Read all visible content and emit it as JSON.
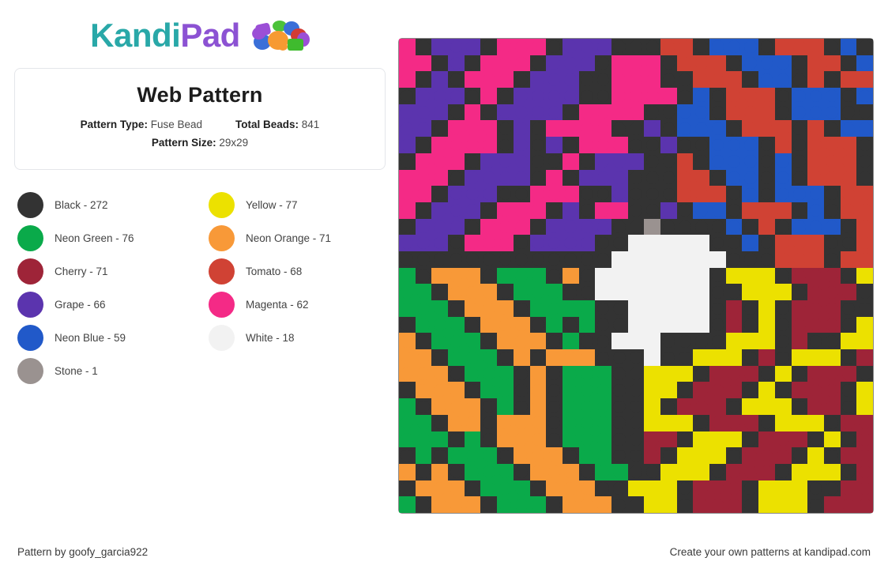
{
  "brand": {
    "name_part1": "Kandi",
    "name_part2": "Pad",
    "logo_icon": "kandi-beads-icon"
  },
  "pattern": {
    "title": "Web Pattern",
    "type_label": "Pattern Type:",
    "type_value": "Fuse Bead",
    "total_label": "Total Beads:",
    "total_value": "841",
    "size_label": "Pattern Size:",
    "size_value": "29x29"
  },
  "legend": {
    "items": [
      {
        "name": "Black",
        "count": 272,
        "label": "Black - 272",
        "color": "#333333"
      },
      {
        "name": "Yellow",
        "count": 77,
        "label": "Yellow - 77",
        "color": "#ece100"
      },
      {
        "name": "Neon Green",
        "count": 76,
        "label": "Neon Green - 76",
        "color": "#0aaa4a"
      },
      {
        "name": "Neon Orange",
        "count": 71,
        "label": "Neon Orange - 71",
        "color": "#f89938"
      },
      {
        "name": "Cherry",
        "count": 71,
        "label": "Cherry - 71",
        "color": "#9e2438"
      },
      {
        "name": "Tomato",
        "count": 68,
        "label": "Tomato - 68",
        "color": "#d04234"
      },
      {
        "name": "Grape",
        "count": 66,
        "label": "Grape - 66",
        "color": "#5b34ae"
      },
      {
        "name": "Magenta",
        "count": 62,
        "label": "Magenta - 62",
        "color": "#f42a86"
      },
      {
        "name": "Neon Blue",
        "count": 59,
        "label": "Neon Blue - 59",
        "color": "#2159c9"
      },
      {
        "name": "White",
        "count": 18,
        "label": "White - 18",
        "color": "#f2f2f2"
      },
      {
        "name": "Stone",
        "count": 1,
        "label": "Stone - 1",
        "color": "#9a9290"
      }
    ]
  },
  "footer": {
    "credit": "Pattern by goofy_garcia922",
    "promo": "Create your own patterns at kandipad.com"
  },
  "chart_data": {
    "type": "heatmap",
    "title": "Web Pattern",
    "rows": 29,
    "cols": 29,
    "palette": {
      "K": "#333333",
      "M": "#f42a86",
      "P": "#5b34ae",
      "R": "#d04234",
      "B": "#2159c9",
      "G": "#0aaa4a",
      "O": "#f89938",
      "Y": "#ece100",
      "C": "#9e2438",
      "W": "#f2f2f2",
      "S": "#9a9290"
    },
    "palette_names": {
      "K": "Black",
      "M": "Magenta",
      "P": "Grape",
      "R": "Tomato",
      "B": "Neon Blue",
      "G": "Neon Green",
      "O": "Neon Orange",
      "Y": "Yellow",
      "C": "Cherry",
      "W": "White",
      "S": "Stone"
    },
    "grid": [
      "MKPPPKMMMKPPPKKKRRKBBBKRRRKBKB",
      "MMKPKMMMKPPPKMMMKRRRKBBBKRRKBK",
      "MKPKMMMKPPPKKMMMKKRRRKBBKRKRRR",
      "KPPPKMKPPPPKKMMMMKBKRRRKBBBKBK",
      "PPPKMKPPPPKMMMMKKBBKRRRKBBBKKR",
      "PPKMMMKPKMMMMKKPKBBBKRRRKRKBBB",
      "PKMMMMKPKPKMMMKKPKKBBBKRKRRRKB",
      "KMMMKPPPKKMKPPPKKRKBBBKBKRRRKB",
      "MMMKPPPPKMKPPPKKKRRKBBKBKRRRKB",
      "MMKPPPKKMMMKKPKKKRRRKBKBBBKRRR",
      "MKPPPKMMMKPKMMKKPKBBKRRRKBKRRR",
      "KPPPKMMMKPPPPKKSKKKKBKRKBBBKRR",
      "PPPKMMMKPPPPKKWWWWWKKBKRRRKKRR",
      "KKKKKKKKKKKKKWWWWWWWKKKRRRKRRR",
      "GKOOOKGGGKOKWWWWWWWKYYYKCCCKYY",
      "GGKOOOKGGGKKWWWWWWWKKYYYKCCCKY",
      "GGGKOOOKGGGGKKWWWWWKCKYKCCCKKY",
      "KGGGKOOOKGKGKKWWWWWKCKYKCCCKYY",
      "OKGGGKOOOKGKKWWWKKKKYYYKCKKYYY",
      "OOKGGGKOKOOOKKKWKKYYYKCKYYYKCC",
      "OOOKGGGKOKGGGKKYYYKCCCKYKCCCKY",
      "KOOOKGGKOKGGGKKYYKCCCKYKCCCKYY",
      "GKOOOKGKOKGGGKKYKCCCKYYYKCCKYY",
      "GGKOOKOOOKGGGKKYYYKCCCKYYYKCCC",
      "GGGKGKOOOKGGGKKCCKYYYKCCCKYKCC",
      "KGKGGGKOOOKGGKKCKYYYKCCCKYKCCC",
      "OKOKGGGKOOOKGGKKYYYKCCCKYYYKCC",
      "KOOOKGGGKOOOKKYYYKCCCKYYYKKCCK",
      "GKOOOKGGGKOOOKKYYKCCCKYYYKCCCK"
    ]
  }
}
